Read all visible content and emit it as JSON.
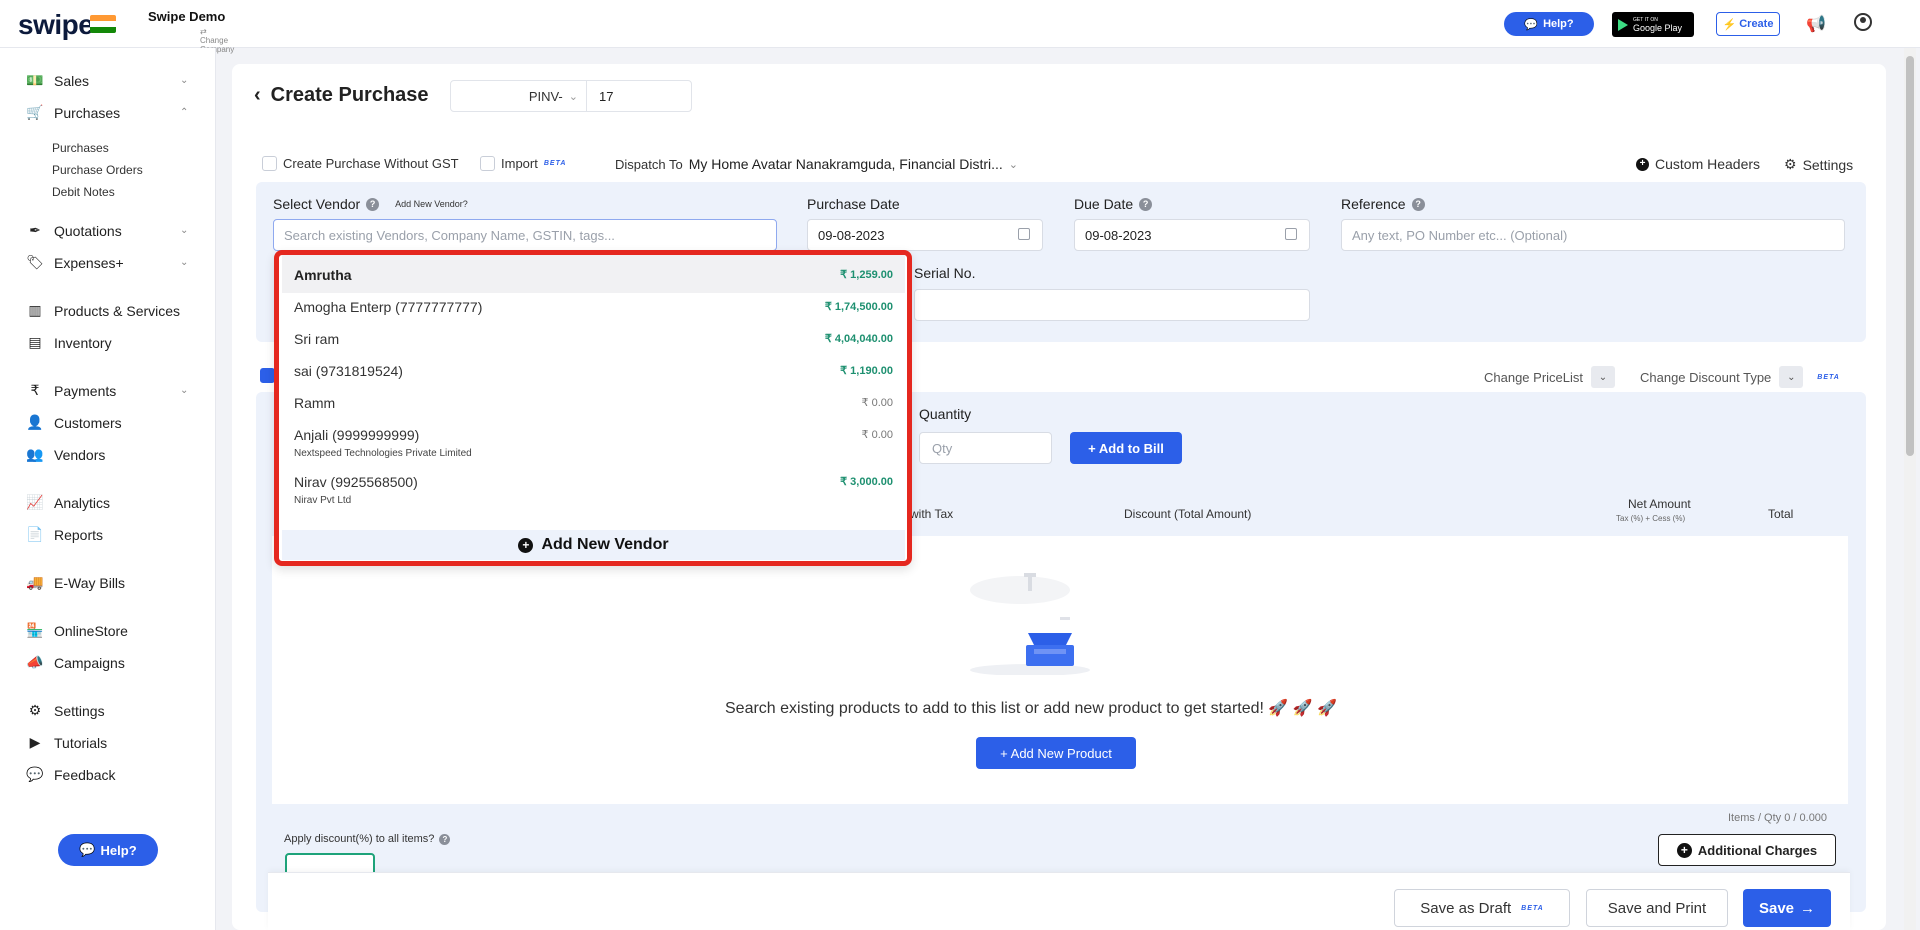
{
  "topbar": {
    "logo": "swipe",
    "company_name": "Swipe Demo",
    "change_company": "⇄ Change Company",
    "help": "Help?",
    "gplay_small": "GET IT ON",
    "gplay_big": "Google Play",
    "create": "Create"
  },
  "sidebar": {
    "sales": "Sales",
    "purchases": "Purchases",
    "sub_purchases": "Purchases",
    "sub_purchase_orders": "Purchase Orders",
    "sub_debit_notes": "Debit Notes",
    "quotations": "Quotations",
    "expenses": "Expenses+",
    "products": "Products & Services",
    "inventory": "Inventory",
    "payments": "Payments",
    "customers": "Customers",
    "vendors": "Vendors",
    "analytics": "Analytics",
    "reports": "Reports",
    "eway": "E-Way Bills",
    "onlinestore": "OnlineStore",
    "campaigns": "Campaigns",
    "settings": "Settings",
    "tutorials": "Tutorials",
    "feedback": "Feedback",
    "help": "Help?"
  },
  "header": {
    "title": "Create Purchase",
    "prefix": "PINV-",
    "number": "17"
  },
  "options": {
    "without_gst": "Create Purchase Without GST",
    "import": "Import",
    "beta": "BETA",
    "dispatch_label": "Dispatch To",
    "dispatch_value": "My Home Avatar Nanakramguda, Financial Distri...",
    "custom_headers": "Custom Headers",
    "settings": "Settings"
  },
  "vendor_form": {
    "select_vendor": "Select Vendor",
    "add_new_vendor_link": "Add New Vendor?",
    "vendor_placeholder": "Search existing Vendors, Company Name, GSTIN, tags...",
    "purchase_date_label": "Purchase Date",
    "purchase_date": "09-08-2023",
    "due_date_label": "Due Date",
    "due_date": "09-08-2023",
    "reference_label": "Reference",
    "reference_placeholder": "Any text, PO Number etc... (Optional)",
    "serial_label": "Serial No."
  },
  "vendor_dropdown": {
    "vendors": [
      {
        "name": "Amrutha",
        "sub": "",
        "amount": "₹ 1,259.00"
      },
      {
        "name": "Amogha Enterp (7777777777)",
        "sub": "",
        "amount": "₹ 1,74,500.00"
      },
      {
        "name": "Sri ram",
        "sub": "",
        "amount": "₹ 4,04,040.00"
      },
      {
        "name": "sai (9731819524)",
        "sub": "",
        "amount": "₹ 1,190.00"
      },
      {
        "name": "Ramm",
        "sub": "",
        "amount": "₹ 0.00"
      },
      {
        "name": "Anjali (9999999999)",
        "sub": "Nextspeed Technologies Private Limited",
        "amount": "₹ 0.00"
      },
      {
        "name": "Nirav (9925568500)",
        "sub": "Nirav Pvt Ltd",
        "amount": "₹ 3,000.00"
      }
    ],
    "add_new_vendor": "Add New Vendor"
  },
  "items": {
    "change_pricelist": "Change PriceList",
    "change_discount_type": "Change Discount Type",
    "beta": "BETA",
    "quantity_label": "Quantity",
    "qty_placeholder": "Qty",
    "add_to_bill": "+ Add to Bill",
    "col_price_with_tax": "e with Tax",
    "col_discount": "Discount (Total Amount)",
    "col_net_amount": "Net Amount",
    "col_net_sub": "Tax (%) + Cess (%)",
    "col_total": "Total",
    "empty_message": "Search existing products to add to this list or add new product to get started! 🚀 🚀 🚀",
    "add_new_product": "+ Add New Product",
    "items_qty": "Items / Qty 0 / 0.000",
    "apply_discount": "Apply discount(%) to all items?",
    "additional_charges": "Additional Charges"
  },
  "footer": {
    "save_draft": "Save as Draft",
    "beta": "BETA",
    "save_print": "Save and Print",
    "save": "Save"
  }
}
